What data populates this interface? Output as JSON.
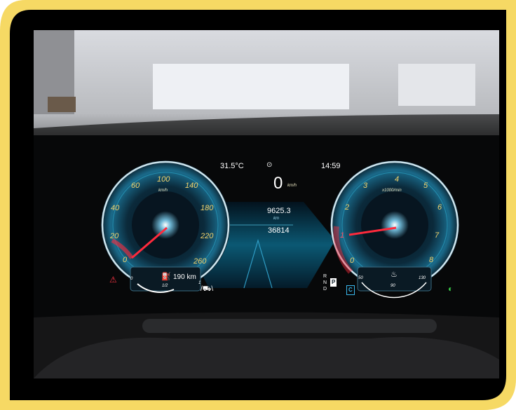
{
  "cluster": {
    "outside_temp": "31.5°C",
    "clock": "14:59",
    "speed": "0",
    "speed_unit": "km/h",
    "odometer_trip": "9625.3",
    "odometer_trip_unit": "km",
    "odometer_total": "36814",
    "range": "190 km",
    "fuel_half": "1/2",
    "fuel_empty": "0",
    "fuel_full": "1",
    "gear_letters": [
      "R",
      "N",
      "P",
      "D"
    ],
    "drive_mode": "C",
    "speedometer": {
      "unit": "km/h",
      "ticks": [
        "0",
        "20",
        "40",
        "60",
        "100",
        "140",
        "180",
        "220",
        "260"
      ]
    },
    "tachometer": {
      "unit": "x1000/min",
      "ticks": [
        "0",
        "1",
        "2",
        "3",
        "4",
        "5",
        "6",
        "7",
        "8"
      ]
    },
    "temp_scale": [
      "50",
      "90",
      "130"
    ],
    "colors": {
      "frame_yellow": "#f6d964",
      "needle_red": "#ff2a3c",
      "tick_yellow": "#f3d36b",
      "dial_blue": "#1aa8c8",
      "lowbeam_green": "#3ad14a"
    }
  }
}
